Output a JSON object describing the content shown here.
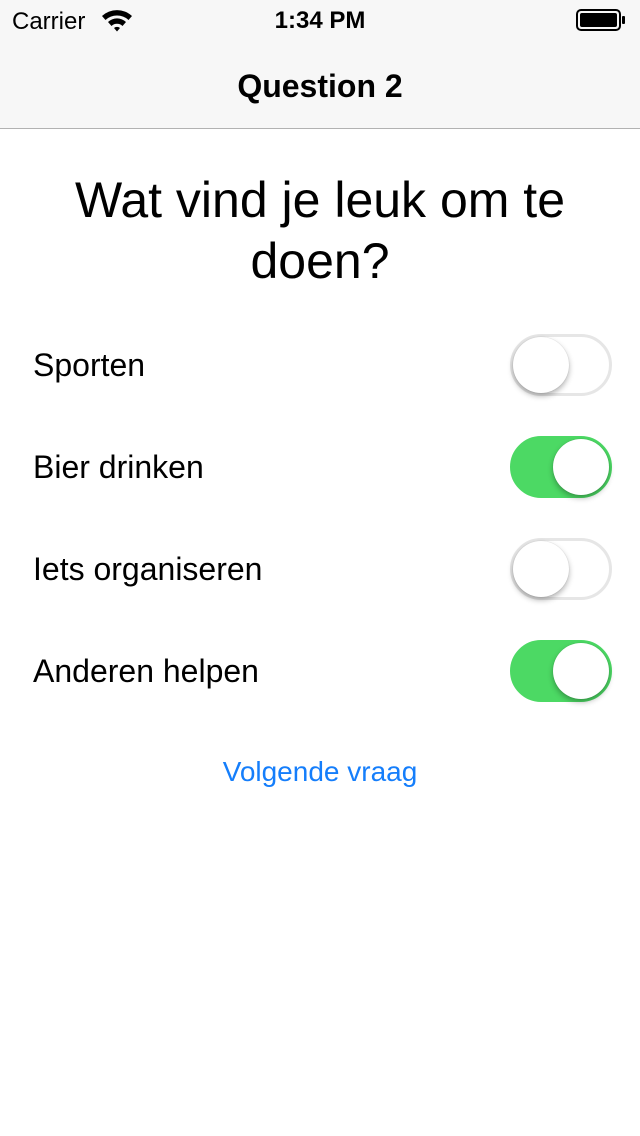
{
  "status_bar": {
    "carrier": "Carrier",
    "time": "1:34 PM"
  },
  "nav": {
    "title": "Question 2"
  },
  "question": {
    "text": "Wat vind je leuk om te doen?"
  },
  "options": [
    {
      "label": "Sporten",
      "on": false
    },
    {
      "label": "Bier drinken",
      "on": true
    },
    {
      "label": "Iets organiseren",
      "on": false
    },
    {
      "label": "Anderen helpen",
      "on": true
    }
  ],
  "next_button": {
    "label": "Volgende vraag"
  },
  "colors": {
    "switch_on": "#4cd964",
    "link": "#157efb"
  }
}
